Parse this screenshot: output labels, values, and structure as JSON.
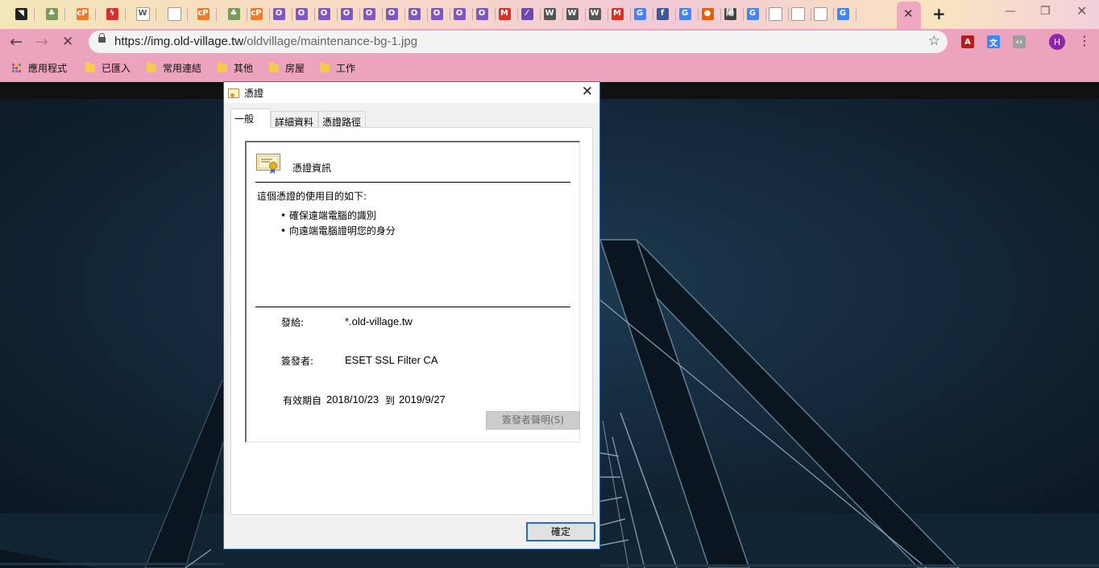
{
  "browser": {
    "tabs": [
      {
        "icon": "black-silhouette-icon",
        "color": "#222222",
        "glyph": "◥"
      },
      {
        "icon": "tree-icon",
        "color": "#7a9a5a",
        "glyph": "♣"
      },
      {
        "icon": "cp-icon",
        "color": "#f07c2a",
        "glyph": "cP"
      },
      {
        "icon": "red-bolt-icon",
        "color": "#d32f2f",
        "glyph": "ϟ"
      },
      {
        "icon": "wikipedia-icon",
        "color": "#ffffff",
        "glyph": "W"
      },
      {
        "icon": "document-icon",
        "color": "#ffffff",
        "glyph": ""
      },
      {
        "icon": "cp-icon",
        "color": "#f07c2a",
        "glyph": "cP"
      },
      {
        "icon": "tree-icon",
        "color": "#7a9a5a",
        "glyph": "♣"
      },
      {
        "icon": "cp-icon",
        "color": "#f07c2a",
        "glyph": "cP"
      },
      {
        "icon": "o-purple-icon",
        "color": "#7e57c2",
        "glyph": "O"
      },
      {
        "icon": "o-purple-icon",
        "color": "#7e57c2",
        "glyph": "O"
      },
      {
        "icon": "o-purple-icon",
        "color": "#7e57c2",
        "glyph": "O"
      },
      {
        "icon": "o-purple-icon",
        "color": "#7e57c2",
        "glyph": "O"
      },
      {
        "icon": "o-purple-icon",
        "color": "#7e57c2",
        "glyph": "O"
      },
      {
        "icon": "o-purple-icon",
        "color": "#7e57c2",
        "glyph": "O"
      },
      {
        "icon": "o-purple-icon",
        "color": "#7e57c2",
        "glyph": "O"
      },
      {
        "icon": "o-purple-icon",
        "color": "#7e57c2",
        "glyph": "O"
      },
      {
        "icon": "o-purple-icon",
        "color": "#7e57c2",
        "glyph": "O"
      },
      {
        "icon": "o-purple-icon",
        "color": "#7e57c2",
        "glyph": "O"
      },
      {
        "icon": "gmail-icon",
        "color": "#d93025",
        "glyph": "M"
      },
      {
        "icon": "feather-icon",
        "color": "#6a4ab0",
        "glyph": "⁄"
      },
      {
        "icon": "wordpress-icon",
        "color": "#555555",
        "glyph": "W"
      },
      {
        "icon": "wordpress-icon",
        "color": "#555555",
        "glyph": "W"
      },
      {
        "icon": "wordpress-icon",
        "color": "#555555",
        "glyph": "W"
      },
      {
        "icon": "gmail-icon",
        "color": "#d93025",
        "glyph": "M"
      },
      {
        "icon": "google-translate-icon",
        "color": "#4285f4",
        "glyph": "G"
      },
      {
        "icon": "facebook-icon",
        "color": "#3b5998",
        "glyph": "f"
      },
      {
        "icon": "google-icon",
        "color": "#4285f4",
        "glyph": "G"
      },
      {
        "icon": "firefox-icon",
        "color": "#e66000",
        "glyph": "●"
      },
      {
        "icon": "chinese-char-icon",
        "color": "#444444",
        "glyph": "陽"
      },
      {
        "icon": "google-icon",
        "color": "#4285f4",
        "glyph": "G"
      },
      {
        "icon": "document-icon",
        "color": "#ffffff",
        "glyph": ""
      },
      {
        "icon": "document-icon",
        "color": "#ffffff",
        "glyph": ""
      },
      {
        "icon": "document-icon",
        "color": "#ffffff",
        "glyph": ""
      },
      {
        "icon": "google-icon",
        "color": "#4285f4",
        "glyph": "G"
      }
    ],
    "active_tab_close": "✕",
    "new_tab": "+",
    "url_host": "https://img.old-village.tw",
    "url_path": "/oldvillage/maintenance-bg-1.jpg",
    "avatar_letter": "H",
    "bookmarks": {
      "apps": "應用程式",
      "folders": [
        "已匯入",
        "常用連結",
        "其他",
        "房屋",
        "工作"
      ]
    }
  },
  "dialog": {
    "title": "憑證",
    "close": "✕",
    "tabs": [
      "一般",
      "詳細資料",
      "憑證路徑"
    ],
    "info_heading": "憑證資訊",
    "purpose_heading": "這個憑證的使用目的如下:",
    "purposes": [
      "• 確保遠端電腦的識別",
      "• 向遠端電腦證明您的身分"
    ],
    "issued_to_label": "發給:",
    "issued_to_value": "*.old-village.tw",
    "issued_by_label": "簽發者:",
    "issued_by_value": "ESET SSL Filter CA",
    "validity_label": "有效期自",
    "valid_from": "2018/10/23",
    "validity_to": "到",
    "valid_to": "2019/9/27",
    "issuer_statement_button": "簽發者聲明(S)",
    "ok_button": "確定"
  }
}
